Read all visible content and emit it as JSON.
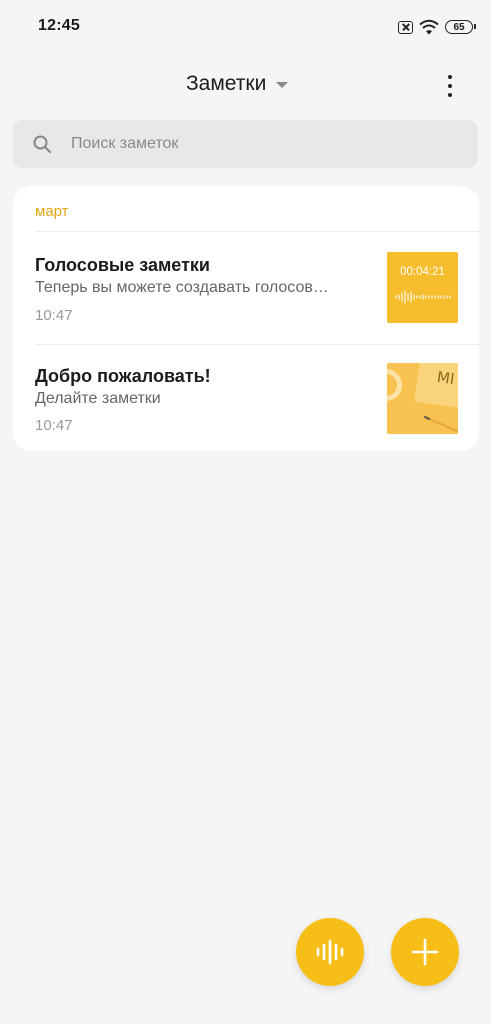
{
  "status_bar": {
    "time": "12:45",
    "battery": "65"
  },
  "header": {
    "title": "Заметки"
  },
  "search": {
    "placeholder": "Поиск заметок"
  },
  "section": {
    "label": "март"
  },
  "notes": [
    {
      "title": "Голосовые заметки",
      "body": "Теперь вы можете создавать голосов…",
      "time": "10:47",
      "thumb_text": "00:04:21"
    },
    {
      "title": "Добро пожаловать!",
      "body": "Делайте заметки",
      "time": "10:47",
      "thumb_text": "MI"
    }
  ],
  "colors": {
    "accent": "#f6be16",
    "section_label": "#e6a817"
  }
}
